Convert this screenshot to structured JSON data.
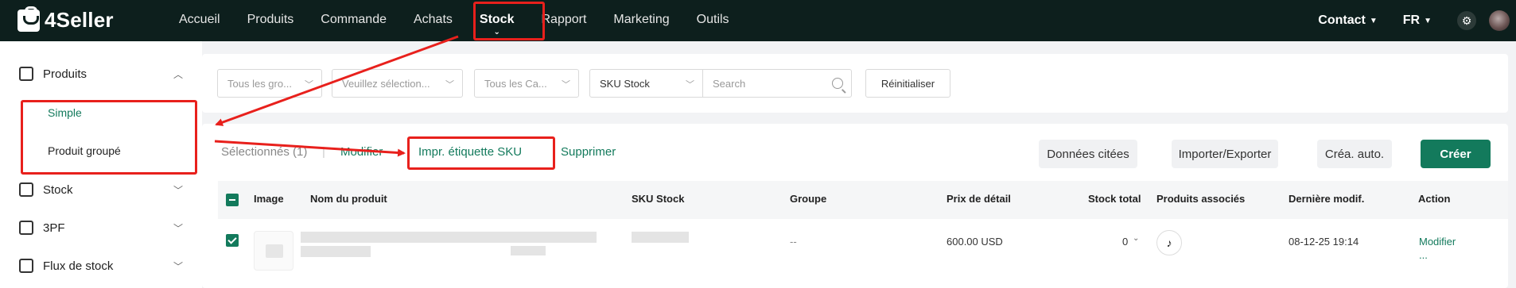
{
  "app": {
    "name": "4Seller"
  },
  "nav": {
    "items": [
      "Accueil",
      "Produits",
      "Commande",
      "Achats",
      "Stock",
      "Rapport",
      "Marketing",
      "Outils"
    ],
    "active": "Stock",
    "contact": "Contact",
    "language": "FR"
  },
  "sidebar": {
    "produits": "Produits",
    "simple": "Simple",
    "produit_groupe": "Produit groupé",
    "stock": "Stock",
    "tpf": "3PF",
    "flux": "Flux de stock"
  },
  "filters": {
    "groupe_placeholder": "Tous les gro...",
    "select_placeholder": "Veuillez sélection...",
    "categorie_placeholder": "Tous les Ca...",
    "field_type": "SKU Stock",
    "search_placeholder": "Search",
    "reset": "Réinitialiser"
  },
  "toolbar": {
    "selected": "Sélectionnés (1)",
    "separator": "|",
    "modifier": "Modifier",
    "print_label": "Impr. étiquette SKU",
    "supprimer": "Supprimer",
    "donnees_citees": "Données citées",
    "importer_exporter": "Importer/Exporter",
    "crea_auto": "Créa. auto.",
    "creer": "Créer"
  },
  "table": {
    "columns": [
      "Image",
      "Nom du produit",
      "SKU Stock",
      "Groupe",
      "Prix de détail",
      "Stock total",
      "Produits associés",
      "Dernière modif.",
      "Action"
    ],
    "rows": [
      {
        "groupe": "--",
        "prix": "600.00 USD",
        "stock_total": "0",
        "derniere_modif": "08-12-25 19:14",
        "action": "Modifier",
        "more": "..."
      }
    ]
  },
  "colors": {
    "brand": "#137a5c",
    "topbar": "#0d1f1d",
    "annotation": "#e8201c"
  }
}
